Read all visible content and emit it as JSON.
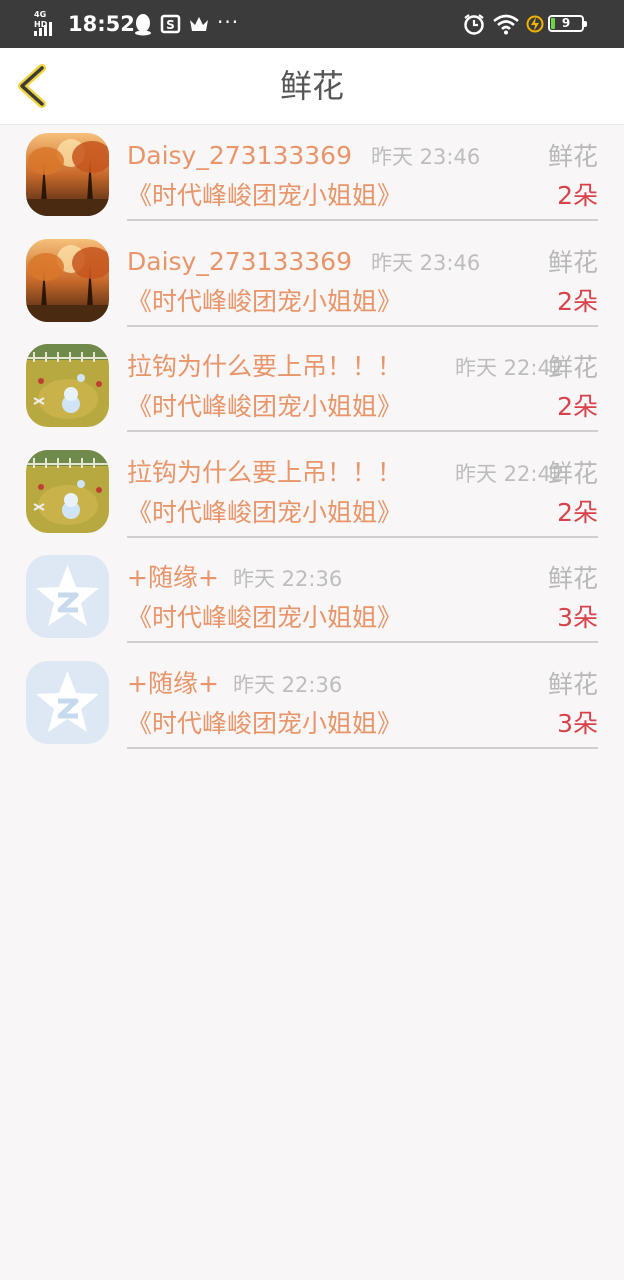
{
  "status_bar": {
    "network": "4G HD",
    "time": "18:52",
    "more": "···",
    "battery": "9"
  },
  "header": {
    "title": "鲜花"
  },
  "records": [
    {
      "name": "Daisy_273133369",
      "time": "昨天 23:46",
      "novel": "《时代峰峻团宠小姐姐》",
      "gift": "鲜花",
      "count": "2朵",
      "avatar": "autumn-forest"
    },
    {
      "name": "Daisy_273133369",
      "time": "昨天 23:46",
      "novel": "《时代峰峻团宠小姐姐》",
      "gift": "鲜花",
      "count": "2朵",
      "avatar": "autumn-forest"
    },
    {
      "name": "拉钩为什么要上吊！！！",
      "time": "昨天 22:42",
      "novel": "《时代峰峻团宠小姐姐》",
      "gift": "鲜花",
      "count": "2朵",
      "avatar": "game-field"
    },
    {
      "name": "拉钩为什么要上吊！！！",
      "time": "昨天 22:42",
      "novel": "《时代峰峻团宠小姐姐》",
      "gift": "鲜花",
      "count": "2朵",
      "avatar": "game-field"
    },
    {
      "name": "+随缘+",
      "time": "昨天 22:36",
      "novel": "《时代峰峻团宠小姐姐》",
      "gift": "鲜花",
      "count": "3朵",
      "avatar": "qq-star"
    },
    {
      "name": "+随缘+",
      "time": "昨天 22:36",
      "novel": "《时代峰峻团宠小姐姐》",
      "gift": "鲜花",
      "count": "3朵",
      "avatar": "qq-star"
    }
  ]
}
